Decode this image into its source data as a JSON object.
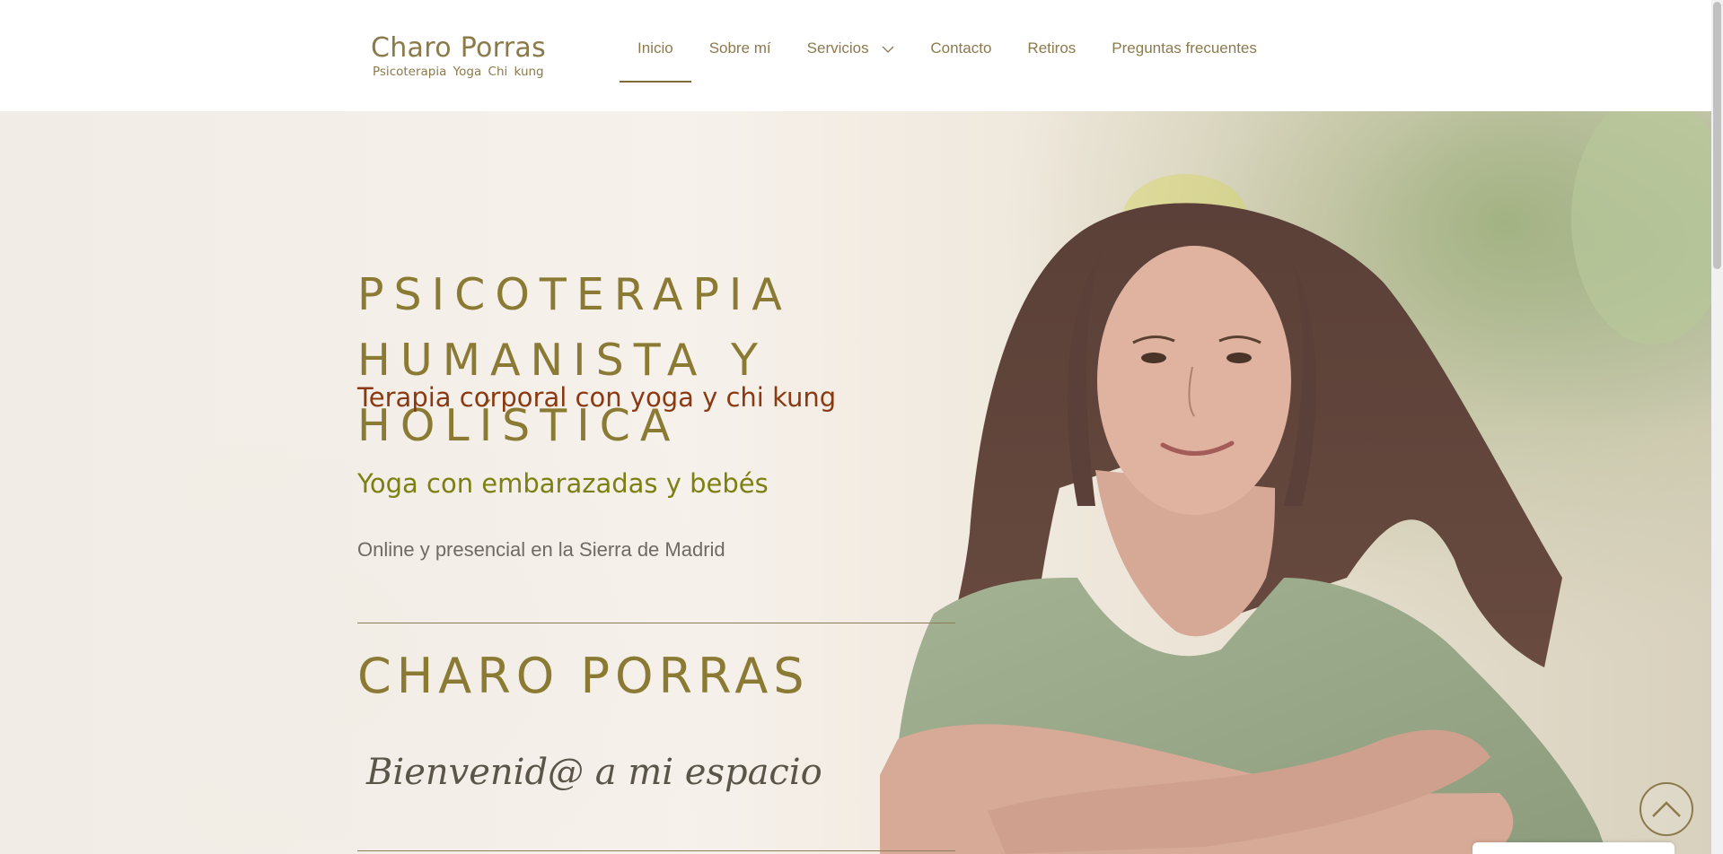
{
  "logo": {
    "title": "Charo Porras",
    "subtitle": "Psicoterapia  Yoga  Chi kung"
  },
  "nav": {
    "items": [
      {
        "label": "Inicio",
        "active": true
      },
      {
        "label": "Sobre mí"
      },
      {
        "label": "Servicios",
        "has_dropdown": true
      },
      {
        "label": "Contacto"
      },
      {
        "label": "Retiros"
      },
      {
        "label": "Preguntas frecuentes"
      }
    ]
  },
  "hero": {
    "heading_lines": [
      "PSICOTERAPIA",
      "HUMANISTA Y",
      "HOLÍSTICA"
    ],
    "subheading_1": "Terapia corporal con yoga y chi kung",
    "subheading_2": "Yoga con embarazadas y bebés",
    "location": "Online y presencial en la Sierra de Madrid",
    "name": "CHARO PORRAS",
    "welcome": "Bienvenid@ a mi espacio"
  },
  "colors": {
    "gold": "#8b7a33",
    "rust": "#8a3a12",
    "olive": "#7c8012",
    "nav_text": "#8c7a4e"
  },
  "icons": {
    "dropdown": "chevron-down-icon",
    "back_to_top": "chevron-up-icon"
  }
}
